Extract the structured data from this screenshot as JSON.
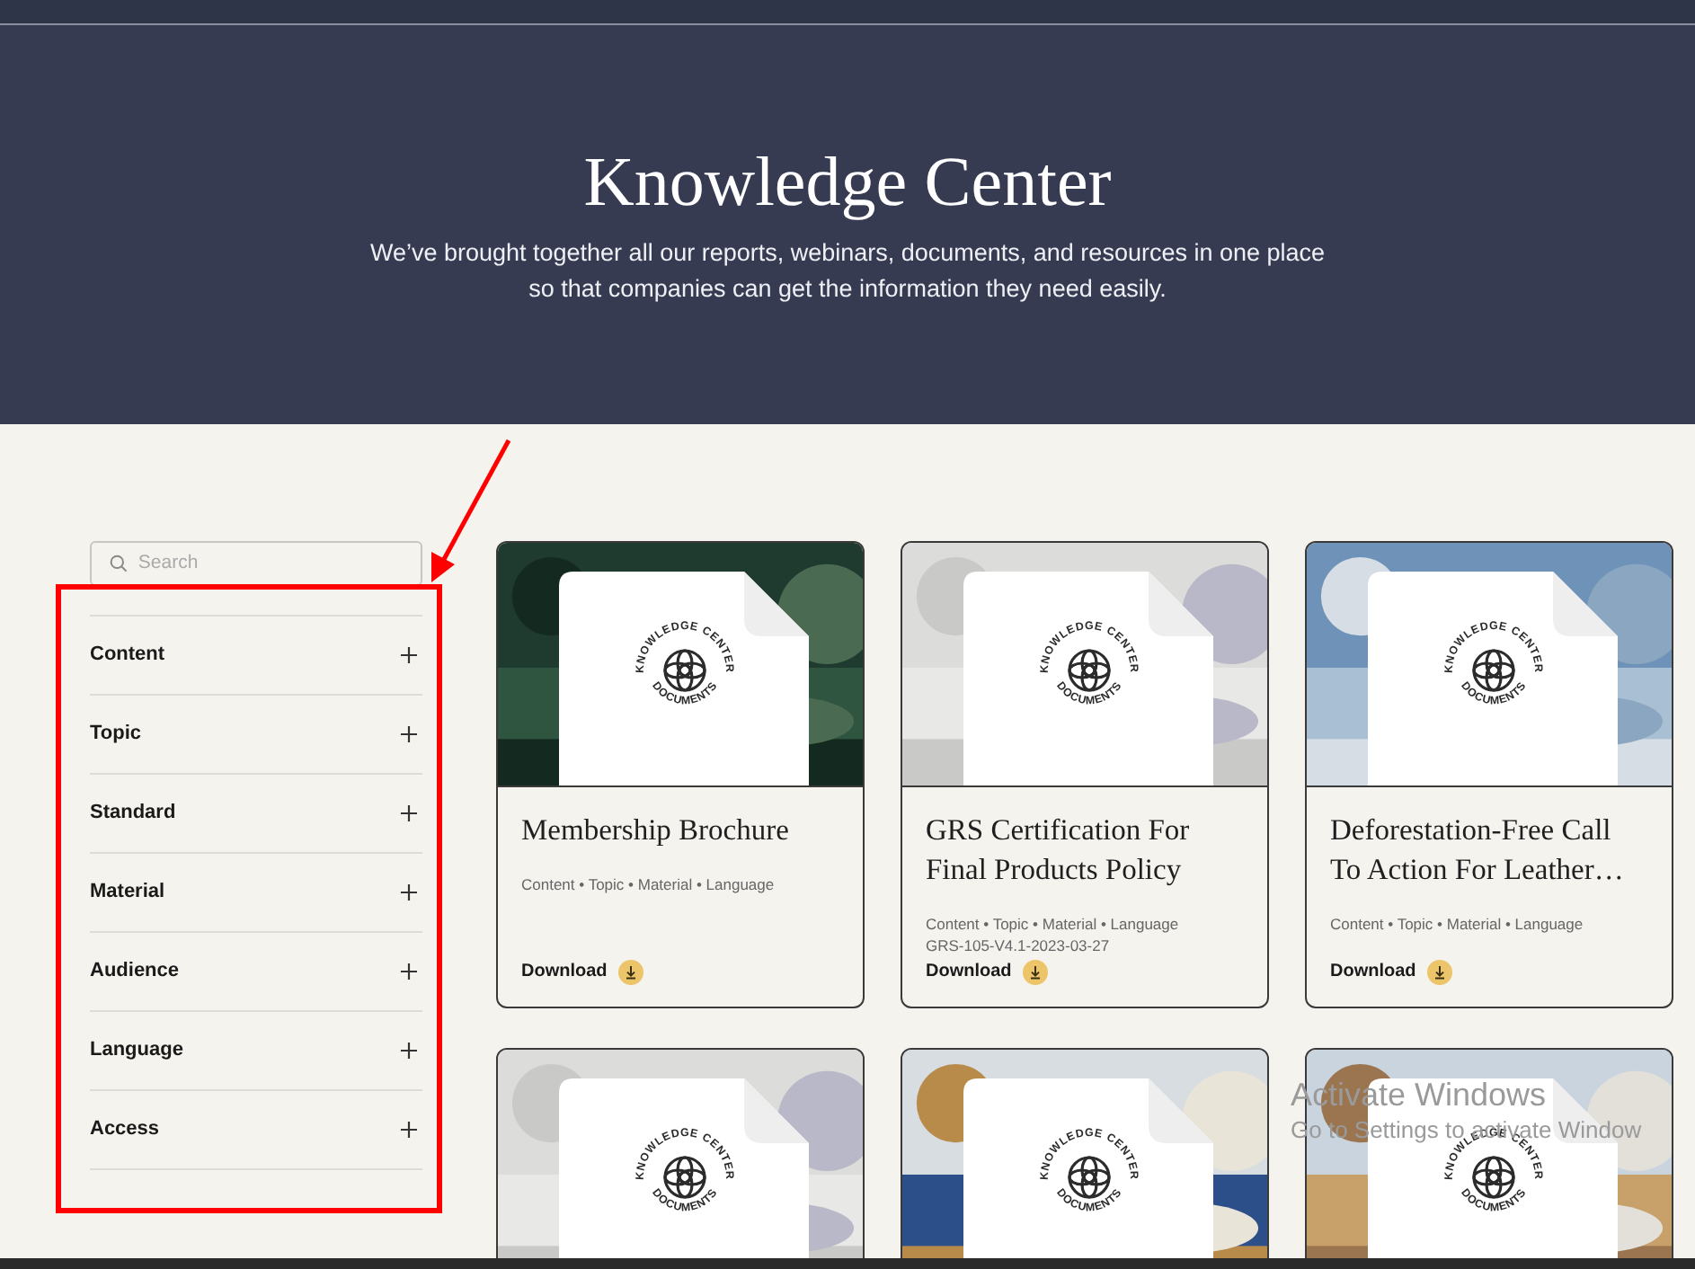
{
  "hero": {
    "title": "Knowledge Center",
    "subtitle": "We’ve brought together all our reports, webinars, documents, and resources in one place so that companies can get the information they need easily."
  },
  "sidebar": {
    "search": {
      "placeholder": "Search"
    },
    "filters": [
      {
        "label": "Content",
        "expanded": false
      },
      {
        "label": "Topic",
        "expanded": false
      },
      {
        "label": "Standard",
        "expanded": false
      },
      {
        "label": "Material",
        "expanded": false
      },
      {
        "label": "Audience",
        "expanded": false
      },
      {
        "label": "Language",
        "expanded": false
      },
      {
        "label": "Access",
        "expanded": false
      }
    ]
  },
  "cards": [
    {
      "seal_top": "KNOWLEDGE CENTER",
      "seal_bottom": "DOCUMENTS",
      "title": "Membership Brochure",
      "meta": "Content • Topic • Material • Language",
      "action": "Download"
    },
    {
      "seal_top": "KNOWLEDGE CENTER",
      "seal_bottom": "DOCUMENTS",
      "title": "GRS Certification For Final Products Policy",
      "meta": "Content • Topic • Material • Language",
      "code": "GRS-105-V4.1-2023-03-27",
      "action": "Download"
    },
    {
      "seal_top": "KNOWLEDGE CENTER",
      "seal_bottom": "DOCUMENTS",
      "title": "Deforestation-Free Call To Action For Leather…",
      "meta": "Content • Topic • Material • Language",
      "action": "Download"
    },
    {
      "seal_top": "KNOWLEDGE CENTER",
      "seal_bottom": "DOCUMENTS"
    },
    {
      "seal_top": "KNOWLEDGE CENTER",
      "seal_bottom": "DOCUMENTS"
    },
    {
      "seal_top": "KNOWLEDGE CENTER",
      "seal_bottom": "DOCUMENTS"
    }
  ],
  "os_notice": {
    "title": "Activate Windows",
    "body": "Go to Settings to activate Window"
  }
}
